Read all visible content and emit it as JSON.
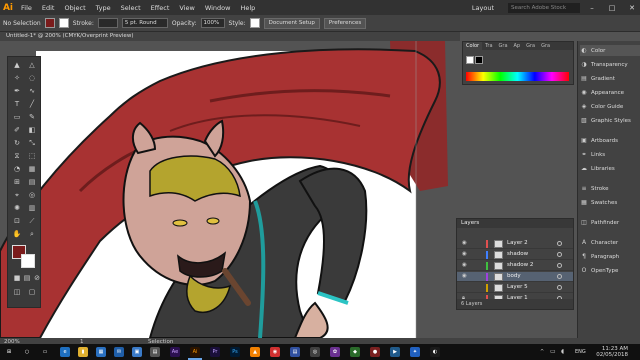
{
  "app": {
    "logo": "Ai",
    "menus": [
      "File",
      "Edit",
      "Object",
      "Type",
      "Select",
      "Effect",
      "View",
      "Window",
      "Help"
    ],
    "workspace": "Layout",
    "search_placeholder": "Search Adobe Stock"
  },
  "control_bar": {
    "selection": "No Selection",
    "stroke_label": "Stroke:",
    "brush": "5 pt. Round",
    "opacity_label": "Opacity:",
    "opacity_value": "100%",
    "style_label": "Style:",
    "document_setup": "Document Setup",
    "preferences": "Preferences",
    "fill_color": "#7a1b1b"
  },
  "document": {
    "tab_title": "Untitled-1* @ 200% (CMYK/Overprint Preview)"
  },
  "color_panel": {
    "tabs": [
      "Color",
      "Tra",
      "Gra",
      "Ap",
      "Gra",
      "Gra"
    ]
  },
  "right_panels": {
    "items": [
      "Color",
      "Transparency",
      "Gradient",
      "Appearance",
      "Color Guide",
      "Graphic Styles",
      "Artboards",
      "Links",
      "Libraries",
      "Stroke",
      "Swatches",
      "Pathfinder",
      "Character",
      "Paragraph",
      "OpenType"
    ]
  },
  "layers_panel": {
    "title": "Layers",
    "layers": [
      {
        "name": "Layer 2",
        "color": "#e05050"
      },
      {
        "name": "shadow",
        "color": "#4080ff"
      },
      {
        "name": "shadow 2",
        "color": "#40c040"
      },
      {
        "name": "body",
        "color": "#a040e0"
      },
      {
        "name": "Layer 5",
        "color": "#d0a000"
      },
      {
        "name": "Layer 1",
        "color": "#e05050"
      }
    ],
    "count": "6 Layers"
  },
  "status_bar": {
    "zoom": "200%",
    "page": "1",
    "tool": "Selection"
  },
  "taskbar": {
    "time": "11:23 AM",
    "date": "02/05/2018",
    "lang": "ENG"
  }
}
